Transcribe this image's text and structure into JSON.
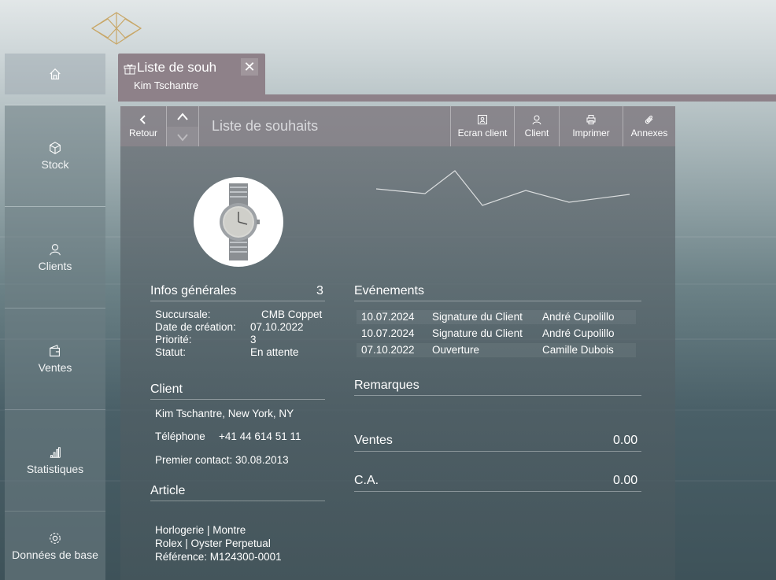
{
  "sidebar": {
    "items": [
      {
        "label": ""
      },
      {
        "label": "Stock"
      },
      {
        "label": "Clients"
      },
      {
        "label": "Ventes"
      },
      {
        "label": "Statistiques"
      },
      {
        "label": "Données de base"
      }
    ]
  },
  "tab": {
    "title": "Liste de souh",
    "subtitle": "Kim Tschantre",
    "close": "✕"
  },
  "toolbar": {
    "back_label": "Retour",
    "page_title": "Liste de souhaits",
    "client_screen_label": "Ecran client",
    "client_label": "Client",
    "print_label": "Imprimer",
    "attachments_label": "Annexes"
  },
  "general": {
    "title": "Infos générales",
    "count": "3",
    "rows": [
      {
        "label": "Succursale:",
        "value": "CMB Coppet"
      },
      {
        "label": "Date de création:",
        "value": "07.10.2022"
      },
      {
        "label": "Priorité:",
        "value": "3"
      },
      {
        "label": "Statut:",
        "value": "En attente"
      }
    ]
  },
  "client": {
    "title": "Client",
    "name_line": "Kim Tschantre, New York, NY",
    "phone_label": "Téléphone",
    "phone": "+41 44 614 51 11",
    "first_contact": "Premier contact: 30.08.2013"
  },
  "article": {
    "title": "Article",
    "lines": [
      "Horlogerie | Montre",
      "Rolex | Oyster Perpetual",
      "Référence: M124300-0001"
    ]
  },
  "events": {
    "title": "Evénements",
    "rows": [
      {
        "date": "10.07.2024",
        "action": "Signature du Client",
        "user": "André Cupolillo"
      },
      {
        "date": "10.07.2024",
        "action": "Signature du Client",
        "user": "André Cupolillo"
      },
      {
        "date": "07.10.2022",
        "action": "Ouverture",
        "user": "Camille Dubois"
      }
    ]
  },
  "remarks": {
    "title": "Remarques"
  },
  "sales": {
    "label": "Ventes",
    "value": "0.00"
  },
  "revenue": {
    "label": "C.A.",
    "value": "0.00"
  },
  "colors": {
    "tab": "#8e8189",
    "toolbar": "#968a92"
  }
}
